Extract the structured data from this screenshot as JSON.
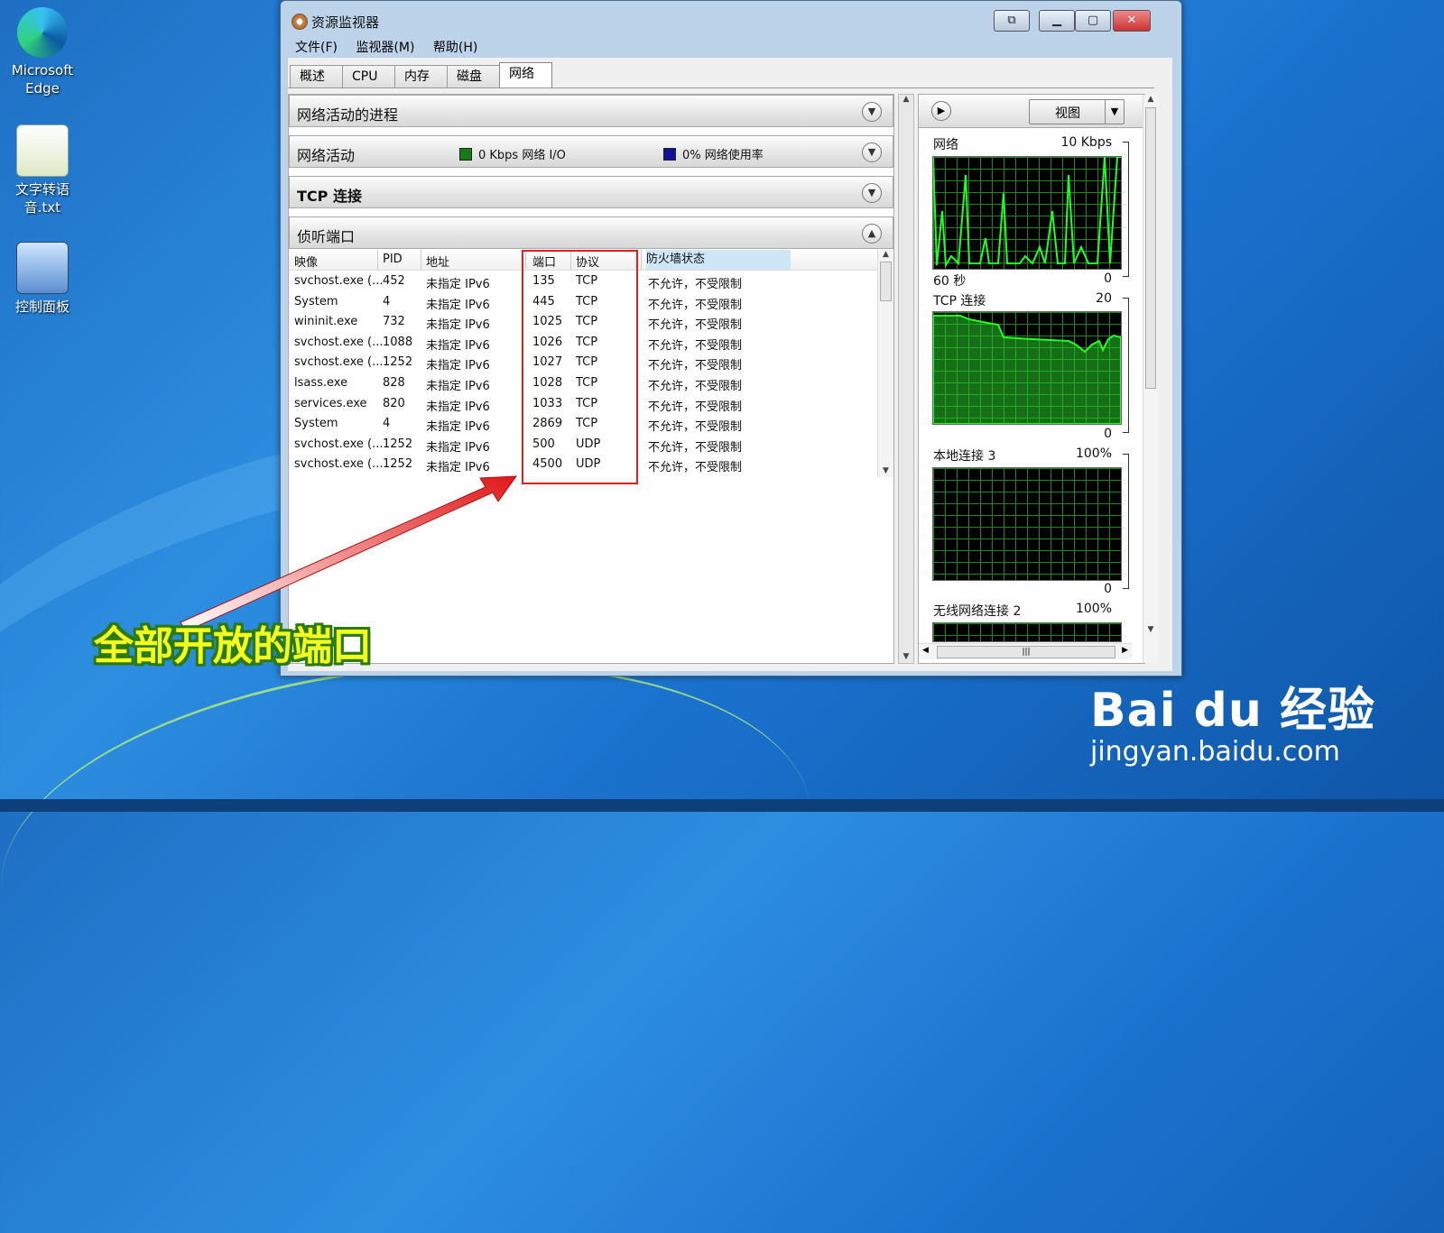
{
  "desktop": {
    "icons": [
      {
        "label": "Microsoft Edge"
      },
      {
        "label": "文字转语音.txt"
      },
      {
        "label": "控制面板"
      }
    ]
  },
  "window": {
    "title": "资源监视器",
    "menu": [
      "文件(F)",
      "监视器(M)",
      "帮助(H)"
    ],
    "tabs": [
      "概述",
      "CPU",
      "内存",
      "磁盘",
      "网络"
    ],
    "active_tab": "网络",
    "sections": {
      "processes": "网络活动的进程",
      "activity": "网络活动",
      "activity_io": "0 Kbps 网络 I/O",
      "activity_usage": "0% 网络使用率",
      "tcp": "TCP 连接",
      "listening": "侦听端口"
    },
    "indicator_colors": {
      "io": "#1a7a1a",
      "usage": "#10109a"
    },
    "table": {
      "headers": [
        "映像",
        "PID",
        "地址",
        "端口",
        "协议",
        "防火墙状态"
      ],
      "rows": [
        [
          "svchost.exe (...",
          "452",
          "未指定 IPv6",
          "135",
          "TCP",
          "不允许，不受限制"
        ],
        [
          "System",
          "4",
          "未指定 IPv6",
          "445",
          "TCP",
          "不允许，不受限制"
        ],
        [
          "wininit.exe",
          "732",
          "未指定 IPv6",
          "1025",
          "TCP",
          "不允许，不受限制"
        ],
        [
          "svchost.exe (...",
          "1088",
          "未指定 IPv6",
          "1026",
          "TCP",
          "不允许，不受限制"
        ],
        [
          "svchost.exe (...",
          "1252",
          "未指定 IPv6",
          "1027",
          "TCP",
          "不允许，不受限制"
        ],
        [
          "lsass.exe",
          "828",
          "未指定 IPv6",
          "1028",
          "TCP",
          "不允许，不受限制"
        ],
        [
          "services.exe",
          "820",
          "未指定 IPv6",
          "1033",
          "TCP",
          "不允许，不受限制"
        ],
        [
          "System",
          "4",
          "未指定 IPv6",
          "2869",
          "TCP",
          "不允许，不受限制"
        ],
        [
          "svchost.exe (...",
          "1252",
          "未指定 IPv6",
          "500",
          "UDP",
          "不允许，不受限制"
        ],
        [
          "svchost.exe (...",
          "1252",
          "未指定 IPv6",
          "4500",
          "UDP",
          "不允许，不受限制"
        ]
      ]
    },
    "right_panel": {
      "view_button": "视图",
      "graphs": [
        {
          "title": "网络",
          "max": "10 Kbps",
          "bottom_left": "60 秒",
          "min": "0"
        },
        {
          "title": "TCP 连接",
          "max": "20",
          "bottom_left": "",
          "min": "0"
        },
        {
          "title": "本地连接 3",
          "max": "100%",
          "bottom_left": "",
          "min": "0"
        },
        {
          "title": "无线网络连接 2",
          "max": "100%",
          "bottom_left": "",
          "min": ""
        }
      ]
    }
  },
  "annotation": {
    "caption": "全部开放的端口",
    "highlight_color": "#e02020"
  },
  "watermark": {
    "brand": "Bai du 经验",
    "url": "jingyan.baidu.com"
  }
}
